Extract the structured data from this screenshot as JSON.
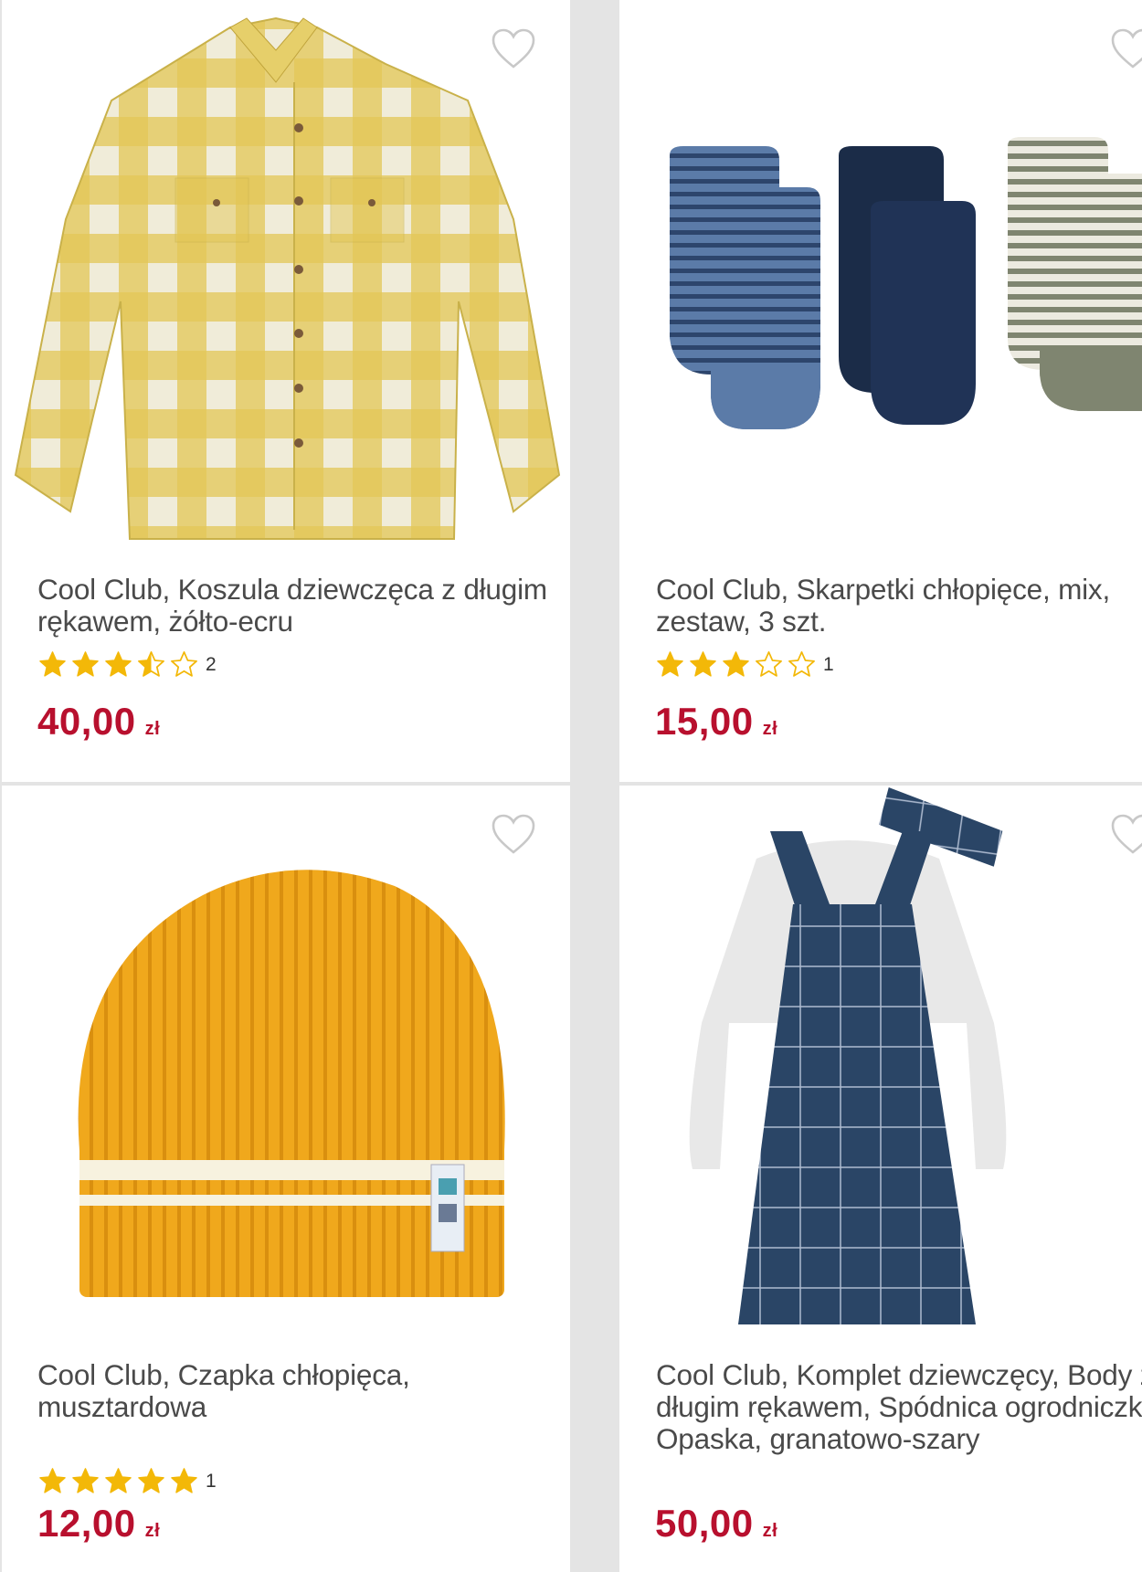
{
  "products": [
    {
      "title": "Cool Club, Koszula dziewczęca z długim rękawem, żółto-ecru",
      "rating": 3.5,
      "rating_count": "2",
      "price": "40,00",
      "currency": "zł"
    },
    {
      "title": "Cool Club, Skarpetki chłopięce, mix, zestaw, 3 szt.",
      "rating": 3,
      "rating_count": "1",
      "price": "15,00",
      "currency": "zł"
    },
    {
      "title": "Cool Club, Czapka chłopięca, musztardowa",
      "rating": 5,
      "rating_count": "1",
      "price": "12,00",
      "currency": "zł"
    },
    {
      "title": "Cool Club, Komplet dziewczęcy, Body z długim rękawem, Spódnica ogrodniczka, Opaska, granatowo-szary",
      "rating": 0,
      "rating_count": "",
      "price": "50,00",
      "currency": "zł"
    }
  ],
  "colors": {
    "price": "#b8102e",
    "star": "#f3b808",
    "heart": "#c8c8c8"
  },
  "icons": {
    "favorite": "heart-outline-icon",
    "star": "star-icon"
  }
}
